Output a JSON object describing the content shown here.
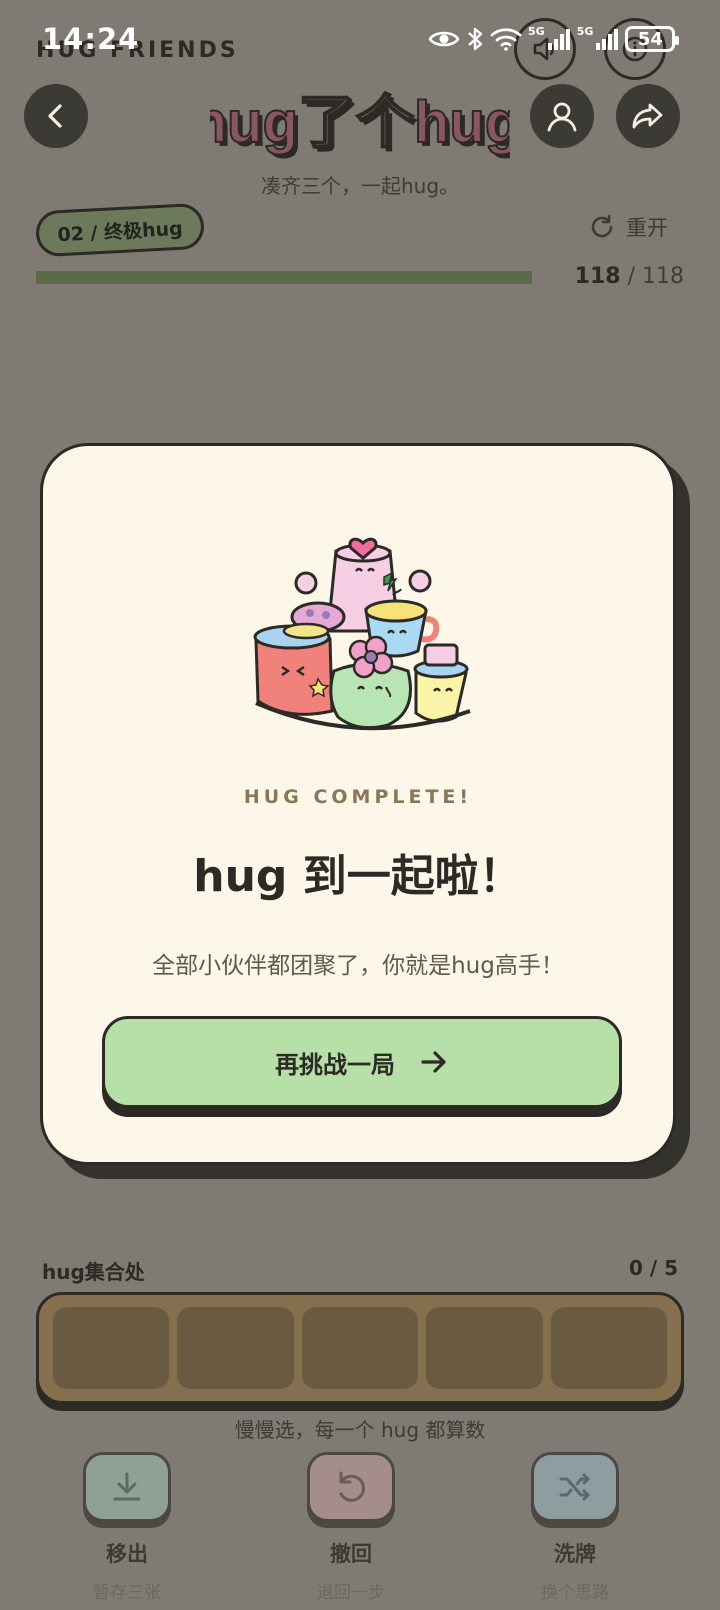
{
  "status_bar": {
    "time": "14:24",
    "signal_1": "5G",
    "signal_2": "5G",
    "battery": "54"
  },
  "app": {
    "brand": "HUG FRIENDS",
    "logo_text": "hug了个hug",
    "subtitle": "凑齐三个，一起hug。"
  },
  "level": {
    "badge": "02 / 终极hug",
    "restart_label": "重开",
    "progress_current": "118",
    "progress_total": "/ 118",
    "progress_fraction": 1.0
  },
  "modal": {
    "kicker": "HUG COMPLETE!",
    "title": "hug 到一起啦！",
    "description": "全部小伙伴都团聚了，你就是hug高手！",
    "cta_label": "再挑战一局"
  },
  "tray": {
    "title": "hug集合处",
    "count": "0 / 5",
    "hint": "慢慢选，每一个 hug 都算数"
  },
  "tools": [
    {
      "name": "移出",
      "sub": "暂存三张",
      "color": "#8fa097"
    },
    {
      "name": "撤回",
      "sub": "退回一步",
      "color": "#a58e8a"
    },
    {
      "name": "洗牌",
      "sub": "换个思路",
      "color": "#8e9da0"
    }
  ],
  "colors": {
    "overlay_bg": "#7f7b74",
    "modal_bg": "#fdf7e9",
    "cta_bg": "#b6e0a8",
    "ink": "#2b2a25"
  }
}
